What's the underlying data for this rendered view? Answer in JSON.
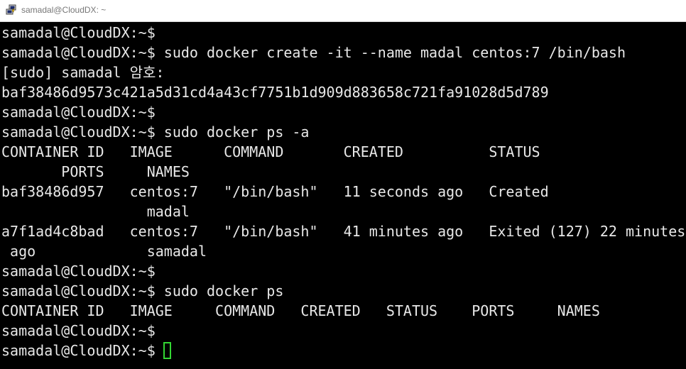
{
  "window": {
    "title": "samadal@CloudDX: ~"
  },
  "terminal": {
    "lines": [
      "samadal@CloudDX:~$",
      "samadal@CloudDX:~$ sudo docker create -it --name madal centos:7 /bin/bash",
      "[sudo] samadal 암호:",
      "baf38486d9573c421a5d31cd4a43cf7751b1d909d883658c721fa91028d5d789",
      "samadal@CloudDX:~$",
      "samadal@CloudDX:~$ sudo docker ps -a",
      "CONTAINER ID   IMAGE      COMMAND       CREATED          STATUS",
      "       PORTS     NAMES",
      "baf38486d957   centos:7   \"/bin/bash\"   11 seconds ago   Created",
      "                 madal",
      "a7f1ad4c8bad   centos:7   \"/bin/bash\"   41 minutes ago   Exited (127) 22 minutes",
      " ago             samadal",
      "samadal@CloudDX:~$",
      "samadal@CloudDX:~$ sudo docker ps",
      "CONTAINER ID   IMAGE     COMMAND   CREATED   STATUS    PORTS     NAMES",
      "samadal@CloudDX:~$",
      "samadal@CloudDX:~$ "
    ],
    "cursor_color": "#33d633"
  }
}
